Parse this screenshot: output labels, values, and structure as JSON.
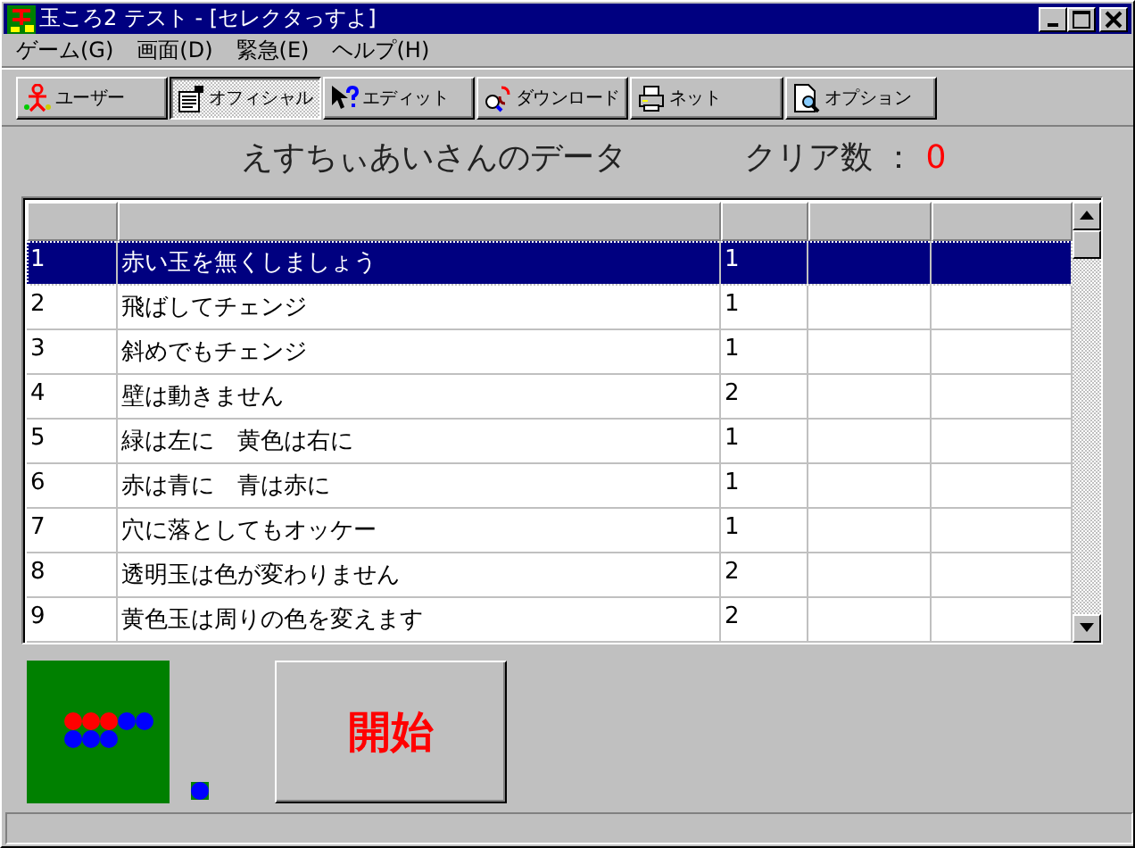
{
  "window": {
    "title": "玉ころ2 テスト - [セレクタっすよ]"
  },
  "menu": [
    "ゲーム(G)",
    "画面(D)",
    "緊急(E)",
    "ヘルプ(H)"
  ],
  "toolbar": [
    {
      "label": "ユーザー",
      "kind": "user",
      "selected": false
    },
    {
      "label": "オフィシャル",
      "kind": "official",
      "selected": true
    },
    {
      "label": "エディット",
      "kind": "edit",
      "selected": false
    },
    {
      "label": "ダウンロード",
      "kind": "download",
      "selected": false
    },
    {
      "label": "ネット",
      "kind": "net",
      "selected": false
    },
    {
      "label": "オプション",
      "kind": "option",
      "selected": false
    }
  ],
  "heading": {
    "title": "えすちぃあいさんのデータ",
    "clear_label": "クリア数 ：",
    "clear_count": "0"
  },
  "table": {
    "rows": [
      {
        "number": "1",
        "name": "赤い玉を無くしましょう",
        "column_3": "1",
        "selected": true
      },
      {
        "number": "2",
        "name": "飛ばしてチェンジ",
        "column_3": "1",
        "selected": false
      },
      {
        "number": "3",
        "name": "斜めでもチェンジ",
        "column_3": "1",
        "selected": false
      },
      {
        "number": "4",
        "name": "壁は動きません",
        "column_3": "2",
        "selected": false
      },
      {
        "number": "5",
        "name": "緑は左に　黄色は右に",
        "column_3": "1",
        "selected": false
      },
      {
        "number": "6",
        "name": "赤は青に　青は赤に",
        "column_3": "1",
        "selected": false
      },
      {
        "number": "7",
        "name": "穴に落としてもオッケー",
        "column_3": "1",
        "selected": false
      },
      {
        "number": "8",
        "name": "透明玉は色が変わりません",
        "column_3": "2",
        "selected": false
      },
      {
        "number": "9",
        "name": "黄色玉は周りの色を変えます",
        "column_3": "2",
        "selected": false
      }
    ]
  },
  "start_button": "開始"
}
